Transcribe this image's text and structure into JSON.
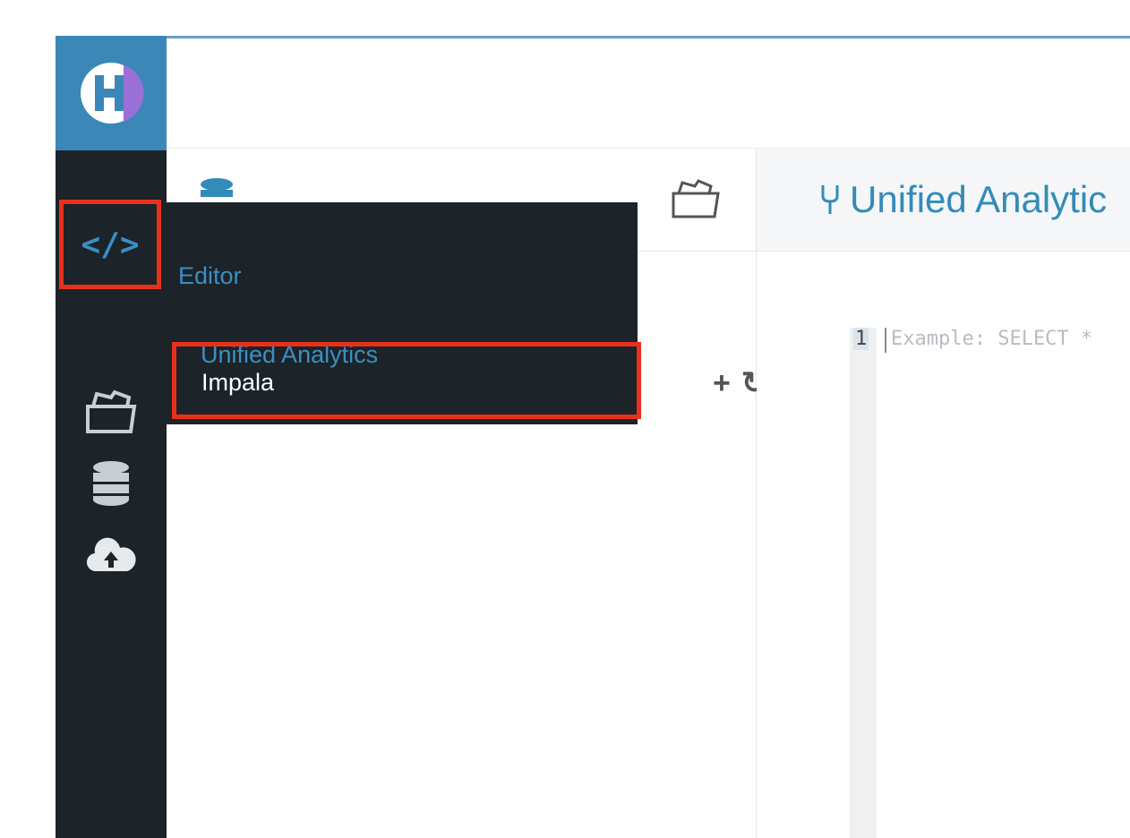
{
  "editor": {
    "title": "Unified Analytic",
    "line_number": "1",
    "placeholder": "Example: SELECT *"
  },
  "sidebar": {
    "editor_icon_label": "</>"
  },
  "flyout": {
    "title": "Editor",
    "items": [
      {
        "label": "Unified Analytics"
      },
      {
        "label": "Impala"
      }
    ]
  },
  "assist": {
    "add_label": "+",
    "refresh_label": "↻"
  },
  "colors": {
    "logo_bg": "#3a87b8",
    "sidebar_bg": "#1c2329",
    "accent": "#3a8fc4",
    "highlight": "#e8311c"
  }
}
